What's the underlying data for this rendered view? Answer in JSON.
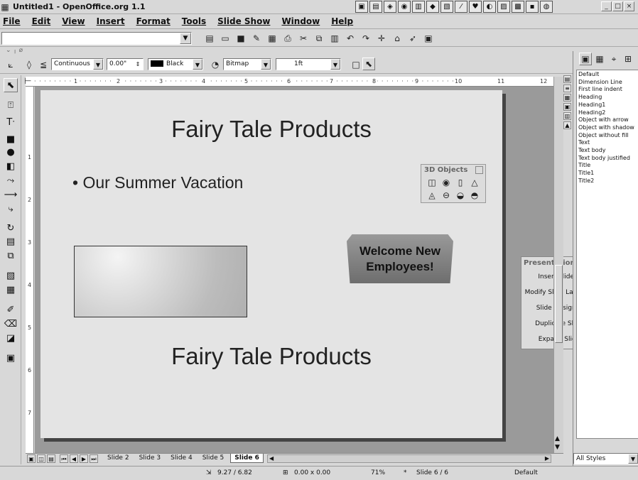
{
  "window": {
    "title": "Untitled1 - OpenOffice.org 1.1",
    "controls": [
      "_",
      "□",
      "×"
    ]
  },
  "menu": [
    "File",
    "Edit",
    "View",
    "Insert",
    "Format",
    "Tools",
    "Slide Show",
    "Window",
    "Help"
  ],
  "object_bar": {
    "line_style": "Continuous",
    "line_width": "0.00\"",
    "line_color": "Black",
    "area_style": "Bitmap",
    "area_value": "1ft"
  },
  "ruler": {
    "horizontal_ticks": [
      "1",
      "2",
      "3",
      "4",
      "5",
      "6",
      "7",
      "8",
      "9",
      "10",
      "11",
      "12"
    ],
    "vertical_ticks": [
      "1",
      "2",
      "3",
      "4",
      "5",
      "6",
      "7"
    ]
  },
  "slide": {
    "title": "Fairy Tale Products",
    "bullet": "Our Summer Vacation",
    "welcome_text": "Welcome New Employees!",
    "bottom_title": "Fairy Tale Products"
  },
  "objects3d": {
    "title": "3D Objects",
    "icons": [
      "cube-icon",
      "sphere-icon",
      "cylinder-icon",
      "cone-icon",
      "pyramid-icon",
      "torus-icon",
      "shell-icon",
      "half-sphere-icon"
    ]
  },
  "presentation": {
    "title": "Presentation",
    "buttons": [
      "Insert Slide...",
      "Modify Slide Layout...",
      "Slide Design...",
      "Duplicate Slide",
      "Expand Slide"
    ]
  },
  "tabs": [
    "Slide 2",
    "Slide 3",
    "Slide 4",
    "Slide 5",
    "Slide 6"
  ],
  "active_tab": "Slide 6",
  "stylist": {
    "styles": [
      "Default",
      "Dimension Line",
      "First line indent",
      "Heading",
      "Heading1",
      "Heading2",
      "Object with arrow",
      "Object with shadow",
      "Object without fill",
      "Text",
      "Text body",
      "Text body justified",
      "Title",
      "Title1",
      "Title2"
    ],
    "filter": "All Styles"
  },
  "status": {
    "position": "9.27 / 6.82",
    "size": "0.00 x 0.00",
    "zoom": "71%",
    "slide": "Slide 6 / 6",
    "layout": "Default"
  }
}
